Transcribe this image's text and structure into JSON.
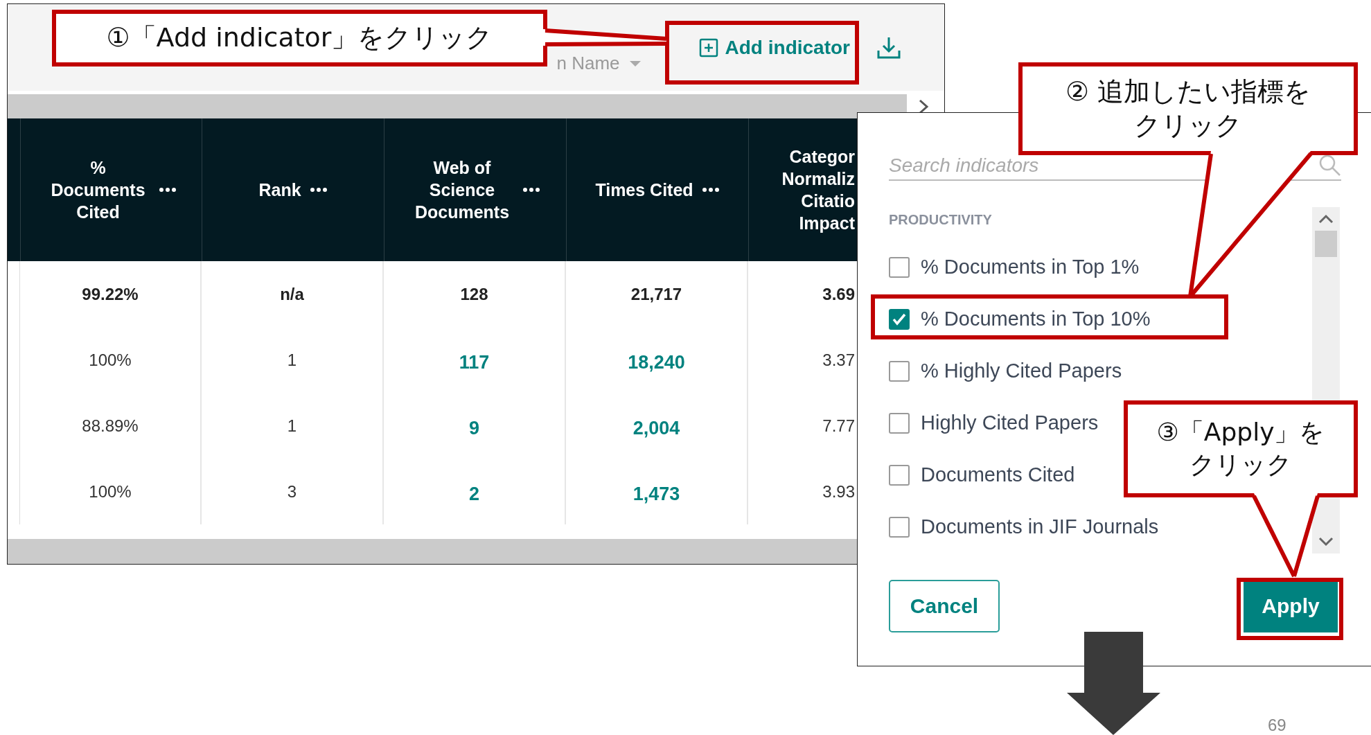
{
  "toolbar": {
    "sort_label": "n Name",
    "add_indicator": "Add indicator"
  },
  "table": {
    "columns": [
      {
        "label": "% Documents Cited",
        "menu": true,
        "linked": false
      },
      {
        "label": "Rank",
        "menu": true,
        "linked": false
      },
      {
        "label": "Web of Science Documents",
        "menu": true,
        "linked": true
      },
      {
        "label": "Times Cited",
        "menu": true,
        "linked": true
      },
      {
        "label": "Categor Normaliz Citatio Impact",
        "menu": false,
        "linked": false
      }
    ],
    "rows": [
      {
        "summary": true,
        "cells": [
          "99.22%",
          "n/a",
          "128",
          "21,717",
          "3.69"
        ]
      },
      {
        "summary": false,
        "cells": [
          "100%",
          "1",
          "117",
          "18,240",
          "3.37"
        ]
      },
      {
        "summary": false,
        "cells": [
          "88.89%",
          "1",
          "9",
          "2,004",
          "7.77"
        ]
      },
      {
        "summary": false,
        "cells": [
          "100%",
          "3",
          "2",
          "1,473",
          "3.93"
        ]
      }
    ]
  },
  "popup": {
    "search": {
      "placeholder": "Search indicators"
    },
    "section": "PRODUCTIVITY",
    "items": [
      {
        "label": "% Documents in Top 1%",
        "checked": false
      },
      {
        "label": "% Documents in Top 10%",
        "checked": true
      },
      {
        "label": "% Highly Cited Papers",
        "checked": false
      },
      {
        "label": "Highly Cited Papers",
        "checked": false
      },
      {
        "label": "Documents Cited",
        "checked": false
      },
      {
        "label": "Documents in JIF Journals",
        "checked": false
      }
    ],
    "buttons": [
      {
        "kind": "secondary",
        "label": "Cancel"
      },
      {
        "kind": "primary",
        "label": "Apply"
      }
    ]
  },
  "callouts": [
    {
      "lines": [
        "①「Add indicator」をクリック"
      ]
    },
    {
      "lines": [
        "② 追加したい指標を",
        "クリック"
      ]
    },
    {
      "lines": [
        "③「Apply」を",
        "クリック"
      ]
    }
  ],
  "page_number": "69"
}
